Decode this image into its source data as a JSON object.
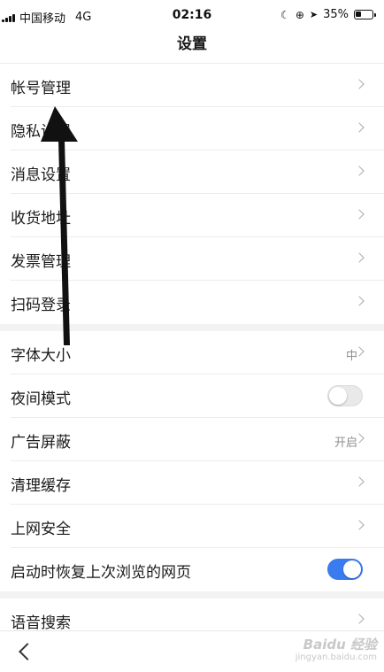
{
  "status_bar": {
    "carrier": "中国移动",
    "network": "4G",
    "time": "02:16",
    "battery_percent_text": "35%",
    "battery_level": 0.35
  },
  "nav": {
    "title": "设置"
  },
  "group1": [
    {
      "label": "帐号管理"
    },
    {
      "label": "隐私设置"
    },
    {
      "label": "消息设置"
    },
    {
      "label": "收货地址"
    },
    {
      "label": "发票管理"
    },
    {
      "label": "扫码登录"
    }
  ],
  "group2": {
    "font_size": {
      "label": "字体大小",
      "value": "中"
    },
    "night_mode": {
      "label": "夜间模式",
      "on": false
    },
    "ad_block": {
      "label": "广告屏蔽",
      "value": "开启"
    },
    "clear_cache": {
      "label": "清理缓存"
    },
    "web_security": {
      "label": "上网安全"
    },
    "restore_pages": {
      "label": "启动时恢复上次浏览的网页",
      "on": true
    }
  },
  "group3": [
    {
      "label": "语音搜索"
    }
  ],
  "watermark": {
    "main": "Baidu 经验",
    "sub": "jingyan.baidu.com"
  },
  "colors": {
    "toggle_on": "#3a7bf0",
    "toggle_off": "#e9e9e9",
    "separator": "#f3f3f3"
  }
}
